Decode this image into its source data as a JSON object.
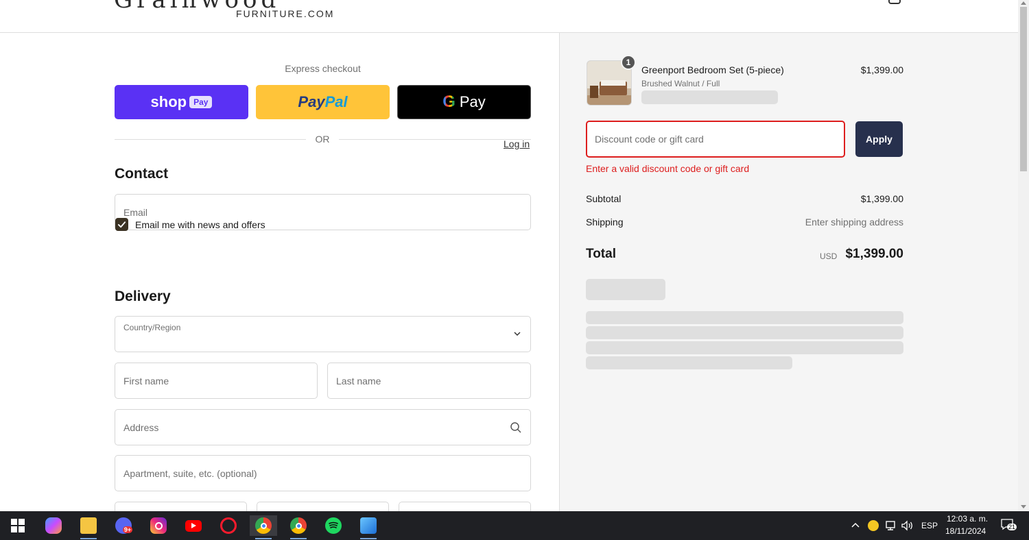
{
  "header": {
    "logo_word": "Grainwood",
    "logo_sub": "FURNITURE.COM"
  },
  "express": {
    "label": "Express checkout",
    "shop_label": "shop",
    "shop_pill": "Pay",
    "paypal_part1": "Pay",
    "paypal_part2": "Pal",
    "gpay_g": "G",
    "gpay_label": "Pay",
    "or_label": "OR"
  },
  "contact": {
    "title": "Contact",
    "login_label": "Log in",
    "email_placeholder": "Email",
    "newsletter_label": "Email me with news and offers",
    "newsletter_checked": true
  },
  "delivery": {
    "title": "Delivery",
    "country_label": "Country/Region",
    "first_name_placeholder": "First name",
    "last_name_placeholder": "Last name",
    "address_placeholder": "Address",
    "apartment_placeholder": "Apartment, suite, etc. (optional)"
  },
  "summary": {
    "item": {
      "quantity": "1",
      "name": "Greenport Bedroom Set (5-piece)",
      "variant": "Brushed Walnut / Full",
      "price": "$1,399.00"
    },
    "discount_placeholder": "Discount code or gift card",
    "apply_label": "Apply",
    "discount_error": "Enter a valid discount code or gift card",
    "subtotal_label": "Subtotal",
    "subtotal_value": "$1,399.00",
    "shipping_label": "Shipping",
    "shipping_value": "Enter shipping address",
    "total_label": "Total",
    "total_currency": "USD",
    "total_value": "$1,399.00"
  },
  "taskbar": {
    "apps": [
      "start-icon",
      "copilot-icon",
      "file-explorer-icon",
      "discord-icon",
      "instagram-icon",
      "youtube-icon",
      "opera-icon",
      "chrome-icon",
      "chrome-profile-icon",
      "spotify-icon",
      "photos-icon"
    ],
    "discord_badge": "9+",
    "language": "ESP",
    "time": "12:03 a. m.",
    "date": "18/11/2024",
    "notification_count": "21"
  },
  "colors": {
    "accent": "#27304d",
    "error": "#dd1d1d",
    "shop_pay": "#5a31f4",
    "paypal": "#ffc439",
    "checkbox": "#3b3223"
  }
}
